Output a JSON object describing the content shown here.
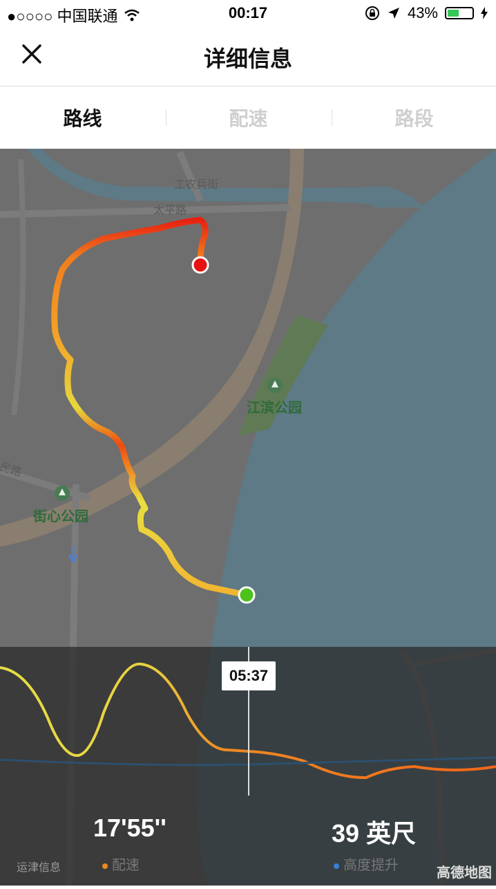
{
  "status_bar": {
    "carrier": "●○○○○ 中国联通",
    "time": "00:17",
    "battery": "43%"
  },
  "nav": {
    "title": "详细信息"
  },
  "tabs": [
    {
      "label": "路线",
      "active": true
    },
    {
      "label": "配速",
      "active": false
    },
    {
      "label": "路段",
      "active": false
    }
  ],
  "map": {
    "road_labels": [
      "工农兵街",
      "太平路",
      "民路"
    ],
    "parks": [
      "江滨公园",
      "街心公园"
    ],
    "bottom_left_label": "运津信息",
    "provider": "高德地图"
  },
  "chart": {
    "time_marker": "05:37"
  },
  "stats": [
    {
      "value": "17'55''",
      "label": "配速",
      "color": "#f08a22"
    },
    {
      "value": "39 英尺",
      "label": "高度提升",
      "color": "#3a7fd6"
    }
  ],
  "colors": {
    "route_start": "#4cc21a",
    "route_end": "#e81010",
    "water": "#6b8a95"
  }
}
